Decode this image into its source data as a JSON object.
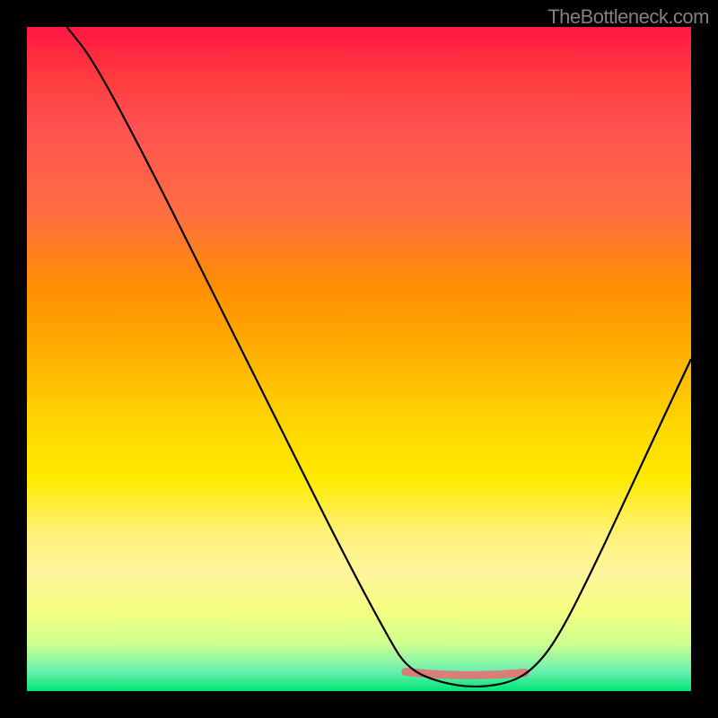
{
  "watermark": "TheBottleneck.com",
  "colors": {
    "gradient_top": "#ff1744",
    "gradient_mid_upper": "#ff5252",
    "gradient_mid": "#ffb300",
    "gradient_mid_lower": "#ffea00",
    "gradient_bottom": "#00e676",
    "curve_stroke": "#000000",
    "band_stroke": "#e57373",
    "background": "#000000"
  },
  "chart_data": {
    "type": "line",
    "title": "",
    "xlabel": "",
    "ylabel": "",
    "x_range_pct": [
      0,
      100
    ],
    "y_range_pct": [
      0,
      100
    ],
    "note": "Axes unlabeled; values are relative percentages of plot area.",
    "series": [
      {
        "name": "bottleneck-curve",
        "points_pct": [
          {
            "x": 6,
            "y": 100
          },
          {
            "x": 10,
            "y": 95
          },
          {
            "x": 18,
            "y": 80
          },
          {
            "x": 28,
            "y": 60
          },
          {
            "x": 38,
            "y": 40
          },
          {
            "x": 48,
            "y": 20
          },
          {
            "x": 55,
            "y": 7
          },
          {
            "x": 57,
            "y": 4
          },
          {
            "x": 60,
            "y": 2
          },
          {
            "x": 66,
            "y": 0.5
          },
          {
            "x": 72,
            "y": 1
          },
          {
            "x": 76,
            "y": 3
          },
          {
            "x": 80,
            "y": 8
          },
          {
            "x": 86,
            "y": 20
          },
          {
            "x": 92,
            "y": 33
          },
          {
            "x": 100,
            "y": 50
          }
        ]
      }
    ],
    "optimal_band_pct": {
      "x_start": 57,
      "x_end": 75,
      "y": 2.5
    },
    "legend": []
  }
}
